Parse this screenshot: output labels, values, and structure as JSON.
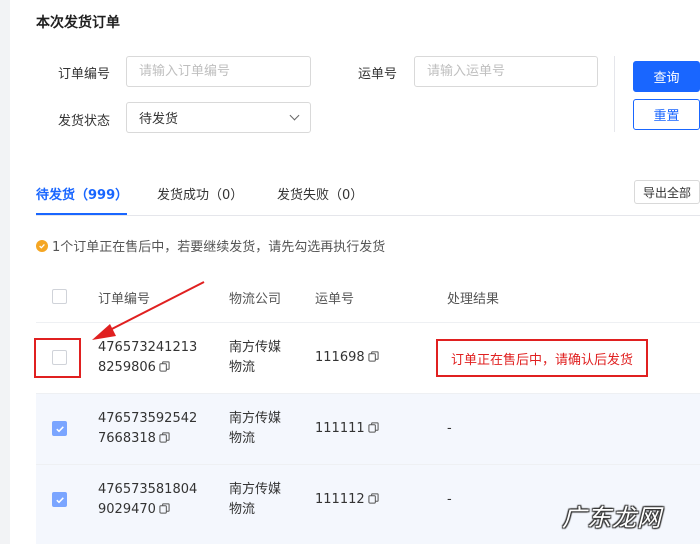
{
  "page": {
    "title": "本次发货订单"
  },
  "form": {
    "order_no_label": "订单编号",
    "order_no_placeholder": "请输入订单编号",
    "waybill_label": "运单号",
    "waybill_placeholder": "请输入运单号",
    "status_label": "发货状态",
    "status_value": "待发货",
    "query_button": "查询",
    "reset_button": "重置"
  },
  "tabs": [
    {
      "label": "待发货（999）",
      "active": true
    },
    {
      "label": "发货成功（0）",
      "active": false
    },
    {
      "label": "发货失败（0）",
      "active": false
    }
  ],
  "export_button": "导出全部",
  "notice": "1个订单正在售后中，若要继续发货，请先勾选再执行发货",
  "table": {
    "headers": [
      "订单编号",
      "物流公司",
      "运单号",
      "处理结果"
    ],
    "rows": [
      {
        "order_line1": "476573241213",
        "order_line2": "8259806",
        "company_line1": "南方传媒",
        "company_line2": "物流",
        "waybill": "111698",
        "result": "订单正在售后中，请确认后发货",
        "checked": false
      },
      {
        "order_line1": "476573592542",
        "order_line2": "7668318",
        "company_line1": "南方传媒",
        "company_line2": "物流",
        "waybill": "111111",
        "result": "-",
        "checked": true
      },
      {
        "order_line1": "476573581804",
        "order_line2": "9029470",
        "company_line1": "南方传媒",
        "company_line2": "物流",
        "waybill": "111112",
        "result": "-",
        "checked": true
      }
    ]
  },
  "watermark": "广东龙网",
  "colors": {
    "primary": "#1966ff",
    "error": "#e02020",
    "warning": "#f5a623",
    "selected_row": "#f4f7fd"
  }
}
